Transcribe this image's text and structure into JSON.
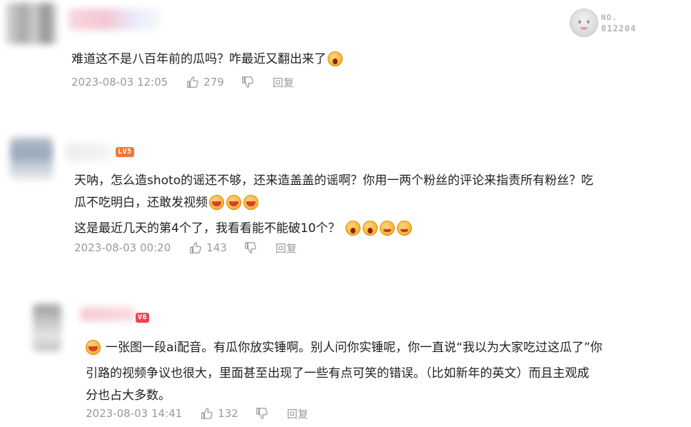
{
  "stamp": {
    "label": "NO.",
    "number": "012204"
  },
  "comments": [
    {
      "text_lines": [
        "难道这不是八百年前的瓜吗？咋最近又翻出来了"
      ],
      "emoji": [
        "scream-face"
      ],
      "time": "2023-08-03 12:05",
      "likes": "279",
      "reply_label": "回复"
    },
    {
      "level": "LV5",
      "text_lines": [
        "天呐，怎么造shoto的谣还不够，还来造盖盖的谣啊？你用一两个粉丝的评论来指责所有粉丝？吃",
        "瓜不吃明白，还敢发视频",
        "这是最近几天的第4个了，我看看能不能破10个？"
      ],
      "emoji_line2": [
        "laugh-cry-face",
        "laugh-cry-face",
        "laugh-cry-face"
      ],
      "emoji_line3": [
        "scream-laugh-face",
        "scream-laugh-face",
        "yum-face",
        "yum-face"
      ],
      "time": "2023-08-03 00:20",
      "likes": "143",
      "reply_label": "回复"
    },
    {
      "level": "V6",
      "text_lines": [
        "一张图一段ai配音。有瓜你放实锤啊。别人问你实锤呢，你一直说“我以为大家吃过这瓜了”你",
        "引路的视频争议也很大，里面甚至出现了一些有点可笑的错误。（比如新年的英文）而且主观成",
        "分也占大多数。"
      ],
      "emoji_lead": [
        "sneer-face"
      ],
      "time": "2023-08-03 14:41",
      "likes": "132",
      "reply_label": "回复"
    }
  ],
  "colors": {
    "text": "#1f1f1f",
    "meta": "#9a9a9a",
    "level_badge": "#f6733a"
  }
}
